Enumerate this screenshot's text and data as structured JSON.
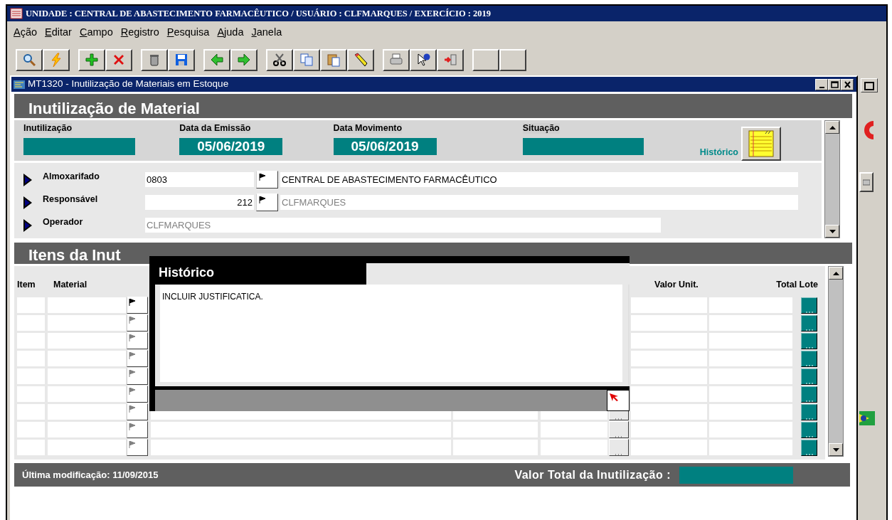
{
  "app_title": "UNIDADE : CENTRAL DE ABASTECIMENTO FARMACÊUTICO / USUÁRIO : CLFMARQUES / EXERCÍCIO : 2019",
  "menu": [
    "Ação",
    "Editar",
    "Campo",
    "Registro",
    "Pesquisa",
    "Ajuda",
    "Janela"
  ],
  "window": {
    "title": "MT1320 - Inutilização de Materiais em Estoque"
  },
  "form_title": "Inutilização de Material",
  "header_fields": [
    {
      "label": "Inutilização"
    },
    {
      "label": "Data da Emissão",
      "value": "05/06/2019"
    },
    {
      "label": "Data Movimento",
      "value": "05/06/2019"
    },
    {
      "label": "Situação"
    }
  ],
  "historico_label": "Histórico",
  "fields": [
    {
      "label": "Almoxarifado",
      "code": "0803",
      "description": "CENTRAL DE ABASTECIMENTO FARMACÊUTICO",
      "disabled": false
    },
    {
      "label": "Responsável",
      "code": "212",
      "description": "CLFMARQUES",
      "disabled": true
    },
    {
      "label": "Operador",
      "description": "CLFMARQUES",
      "disabled": true
    }
  ],
  "items": {
    "title": "Itens da Inut",
    "columns": [
      {
        "label": "Item"
      },
      {
        "label": "Material"
      },
      {
        "label": "Valor Unit."
      },
      {
        "label": "Total Lote"
      }
    ],
    "rows": [
      {
        "current": true
      },
      {
        "current": false
      },
      {
        "current": false
      },
      {
        "current": false
      },
      {
        "current": false
      },
      {
        "current": false
      },
      {
        "current": false
      },
      {
        "current": false
      },
      {
        "current": false
      }
    ]
  },
  "footer": {
    "last_modified": "Última modificação: 11/09/2015",
    "total_label": "Valor Total da Inutilização :"
  },
  "dialog": {
    "title": "Histórico",
    "text": "INCLUIR JUSTIFICATICA."
  }
}
